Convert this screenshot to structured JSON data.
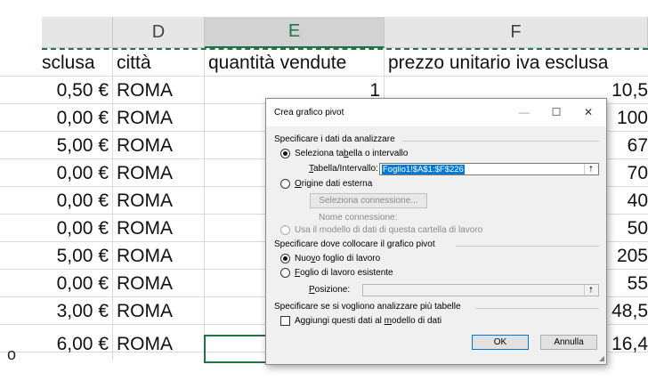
{
  "columns": [
    {
      "letter": "D"
    },
    {
      "letter": "E"
    },
    {
      "letter": "F"
    }
  ],
  "header_row": {
    "c": "sclusa",
    "d": "città",
    "e": "quantità vendute",
    "f": "prezzo unitario iva esclusa"
  },
  "rows": [
    {
      "c": "0,50 €",
      "d": "ROMA",
      "e": "1",
      "f": "10,5"
    },
    {
      "c": "0,00 €",
      "d": "ROMA",
      "e": "",
      "f": "100"
    },
    {
      "c": "5,00 €",
      "d": "ROMA",
      "e": "",
      "f": "67"
    },
    {
      "c": "0,00 €",
      "d": "ROMA",
      "e": "",
      "f": "70"
    },
    {
      "c": "0,00 €",
      "d": "ROMA",
      "e": "",
      "f": "40"
    },
    {
      "c": "0,00 €",
      "d": "ROMA",
      "e": "",
      "f": "50"
    },
    {
      "c": "5,00 €",
      "d": "ROMA",
      "e": "",
      "f": "205"
    },
    {
      "c": "0,00 €",
      "d": "ROMA",
      "e": "",
      "f": "55"
    },
    {
      "c": "3,00 €",
      "d": "ROMA",
      "e": "",
      "f": "48,5"
    },
    {
      "c": "6,00 €",
      "d": "ROMA",
      "e": "",
      "f": "16,4"
    }
  ],
  "bullet": "o",
  "dialog": {
    "title": "Crea grafico pivot",
    "section1": "Specificare i dati da analizzare",
    "opt_select_pre": "Seleziona ta",
    "opt_select_key": "b",
    "opt_select_post": "ella o intervallo",
    "range_label_key": "T",
    "range_label_rest": "abella/Intervallo:",
    "range_value": "Foglio1!$A$1:$F$226",
    "opt_external_key": "O",
    "opt_external_rest": "rigine dati esterna",
    "select_connection": "Seleziona connessione...",
    "connection_name_label": "Nome connessione:",
    "opt_model": "Usa il modello di dati di questa cartella di lavoro",
    "section2": "Specificare dove collocare il grafico pivot",
    "opt_new_pre": "Nuo",
    "opt_new_key": "v",
    "opt_new_post": "o foglio di lavoro",
    "opt_existing_key": "F",
    "opt_existing_rest": "oglio di lavoro esistente",
    "position_label_key": "P",
    "position_label_rest": "osizione:",
    "section3": "Specificare se si vogliono analizzare più tabelle",
    "add_model_pre": "Aggiungi questi dati al ",
    "add_model_key": "m",
    "add_model_post": "odello di dati",
    "ok": "OK",
    "cancel": "Annulla",
    "min_glyph": "—",
    "max_glyph": "☐",
    "close_glyph": "✕",
    "collapse_glyph": "⭡"
  },
  "colors": {
    "excel_green": "#217346",
    "selection_blue": "#0078d7"
  }
}
